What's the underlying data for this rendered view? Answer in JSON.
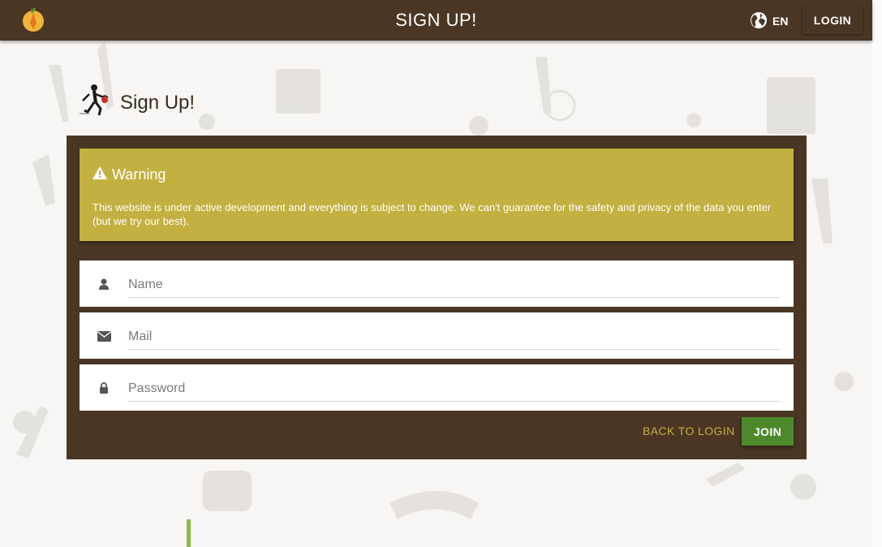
{
  "topbar": {
    "title": "SIGN UP!",
    "language_label": "EN",
    "login_label": "LOGIN"
  },
  "page": {
    "title": "Sign Up!"
  },
  "warning": {
    "heading": "Warning",
    "text": "This website is under active development and everything is subject to change. We can't guarantee for the safety and privacy of the data you enter (but we try our best)."
  },
  "form": {
    "name_placeholder": "Name",
    "mail_placeholder": "Mail",
    "password_placeholder": "Password",
    "back_label": "BACK TO LOGIN",
    "join_label": "JOIN"
  },
  "colors": {
    "brand_brown": "#4a3623",
    "warning_yellow": "#c2b040",
    "join_green": "#4e8a2c"
  },
  "icons": {
    "logo": "carrot-logo-icon",
    "language": "globe-icon",
    "page": "runner-with-basket-icon",
    "warning": "warning-triangle-icon",
    "name": "user-icon",
    "mail": "envelope-icon",
    "password": "lock-icon"
  }
}
